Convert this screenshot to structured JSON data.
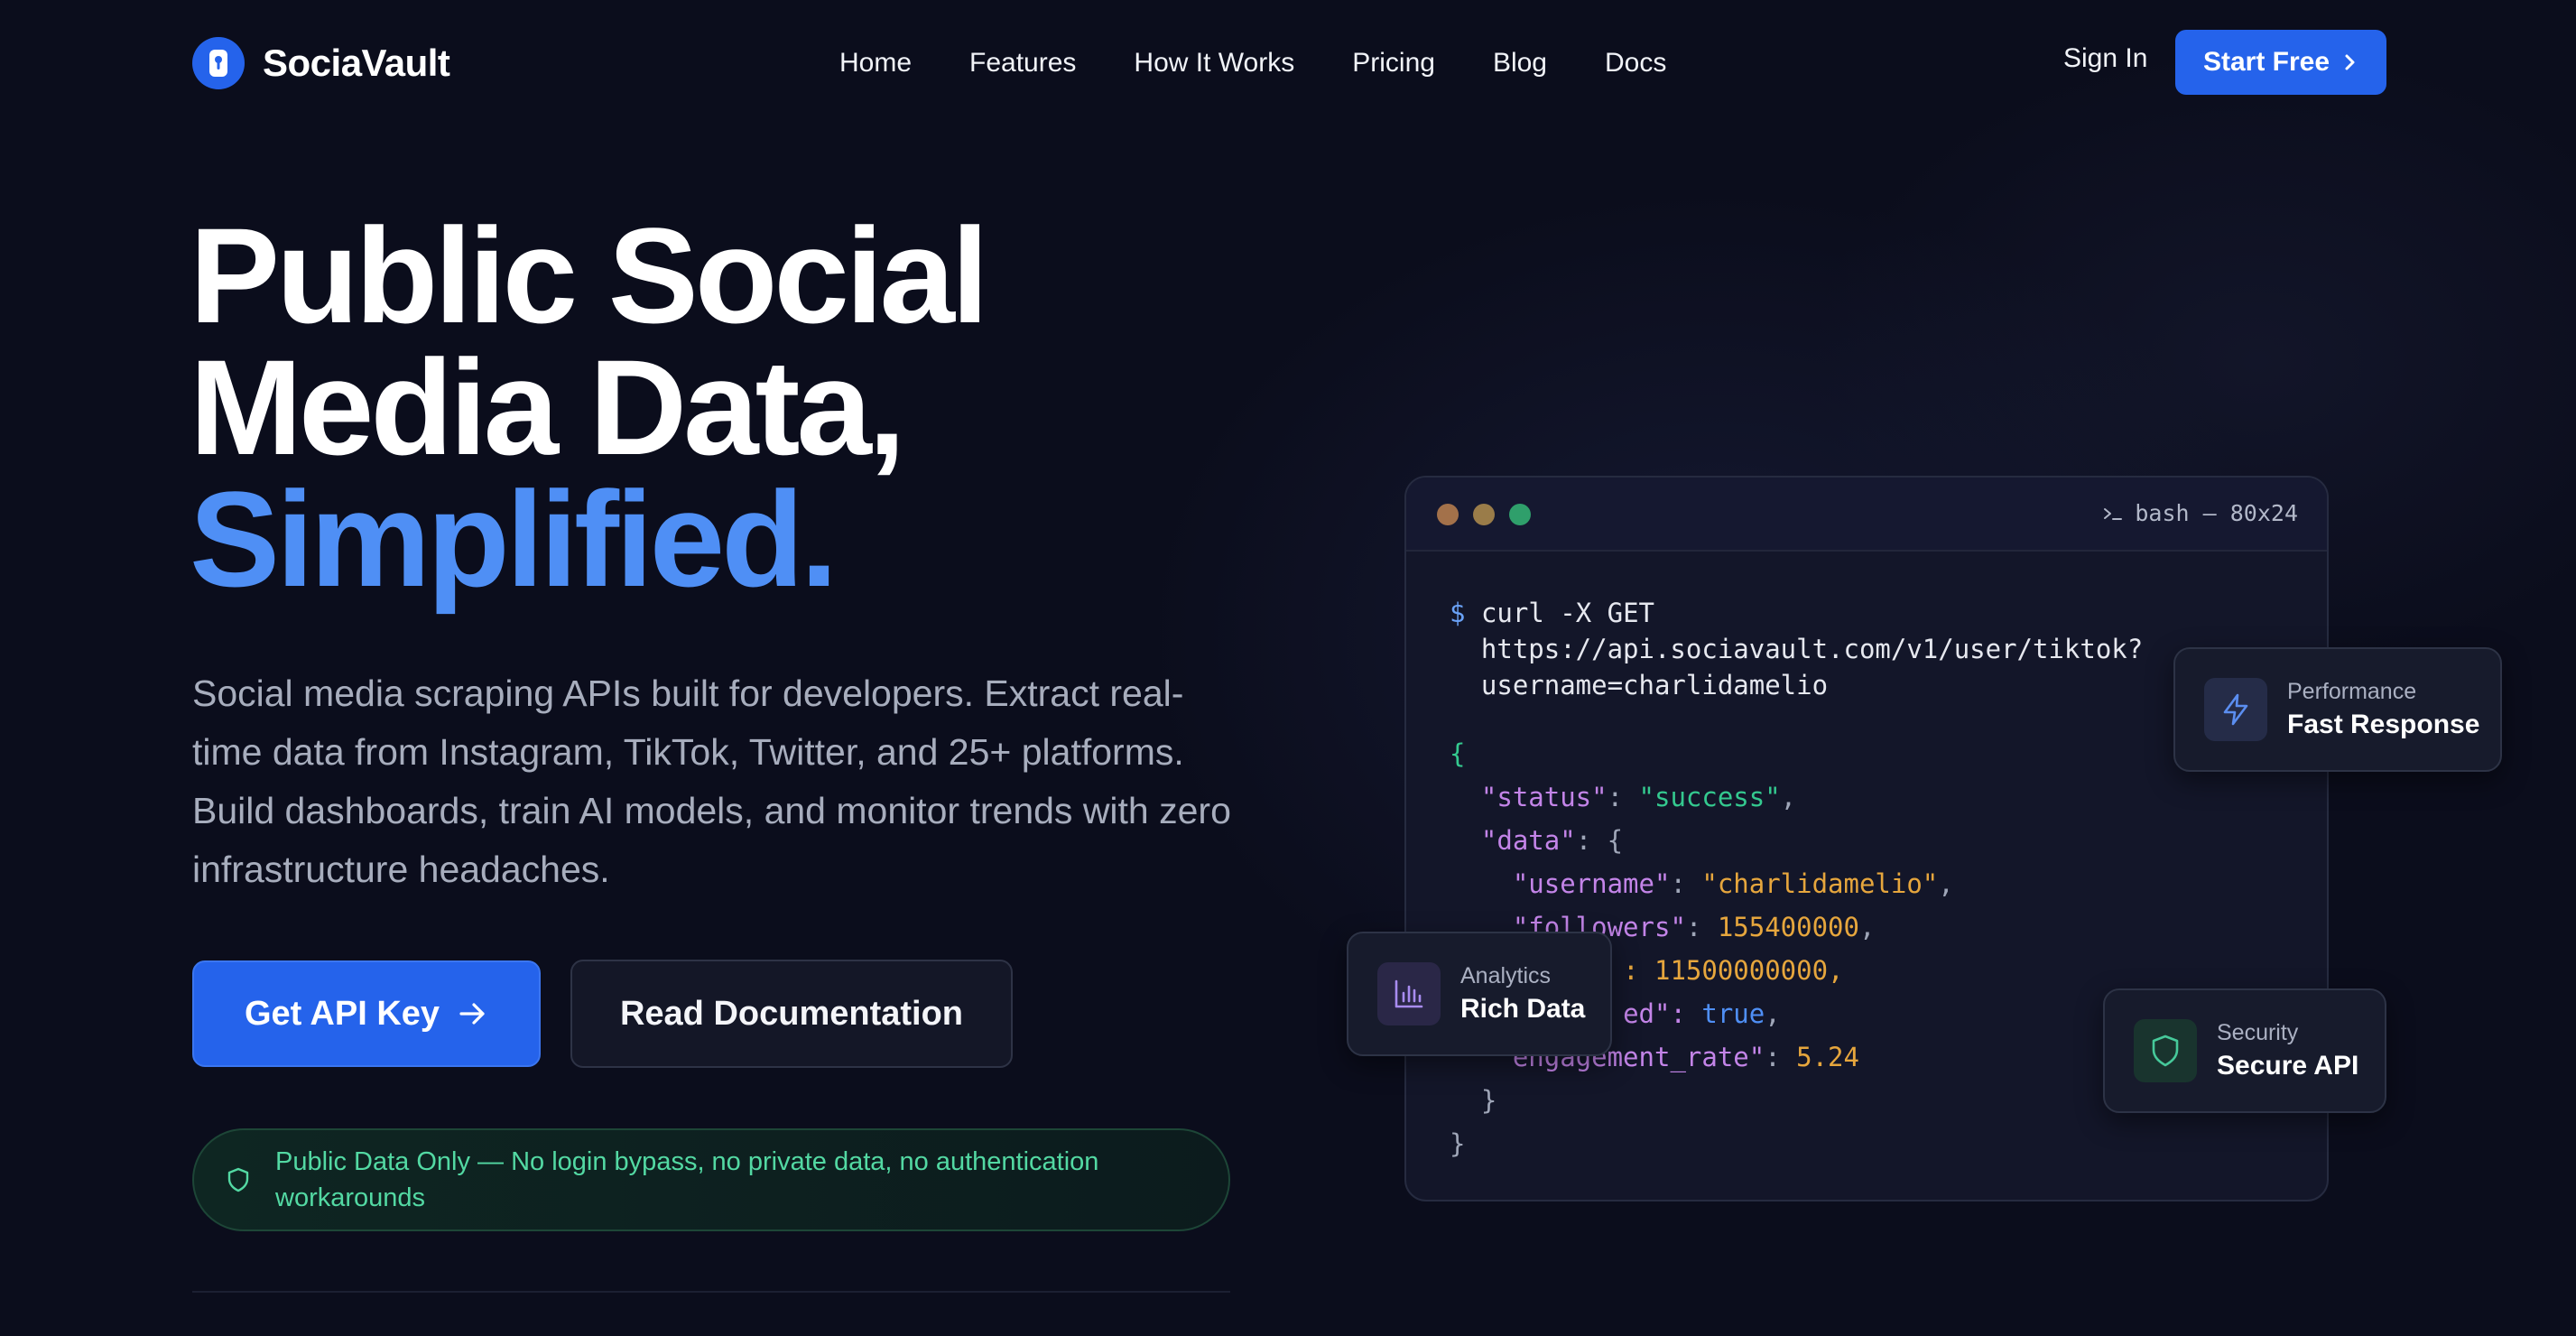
{
  "nav": {
    "brand": "SociaVault",
    "links": [
      "Home",
      "Features",
      "How It Works",
      "Pricing",
      "Blog",
      "Docs"
    ],
    "sign_in": "Sign In",
    "start_free": "Start Free"
  },
  "hero": {
    "title_line1": "Public Social",
    "title_line2": "Media Data,",
    "title_line3": "Simplified.",
    "subtitle": "Social media scraping APIs built for developers. Extract real-time data from Instagram, TikTok, Twitter, and 25+ platforms. Build dashboards, train AI models, and monitor trends with zero infrastructure headaches.",
    "primary_button": "Get API Key",
    "secondary_button": "Read Documentation",
    "notice": "Public Data Only — No login bypass, no private data, no authentication workarounds"
  },
  "terminal": {
    "title": "bash — 80x24",
    "prompt": "$",
    "command_line1": "curl -X GET",
    "command_line2": "https://api.sociavault.com/v1/user/tiktok?",
    "command_line3": "username=charlidamelio",
    "json": {
      "status_key": "\"status\"",
      "status_val": "\"success\"",
      "data_key": "\"data\"",
      "username_key": "\"username\"",
      "username_val": "\"charlidamelio\"",
      "followers_key": "\"followers\"",
      "followers_val": "155400000",
      "likes_partial": ": 11500000000,",
      "verified_partial": "ed\": ",
      "verified_val": "true",
      "engagement_partial": "engagement_rate\"",
      "engagement_val": "5.24"
    }
  },
  "cards": {
    "performance": {
      "label": "Performance",
      "value": "Fast Response",
      "icon": "lightning-icon"
    },
    "analytics": {
      "label": "Analytics",
      "value": "Rich Data",
      "icon": "bar-chart-icon"
    },
    "security": {
      "label": "Security",
      "value": "Secure API",
      "icon": "shield-icon"
    }
  },
  "colors": {
    "background": "#0b0d1c",
    "accent": "#2563eb",
    "accent_text": "#4f8ff5",
    "success": "#34c98f"
  }
}
